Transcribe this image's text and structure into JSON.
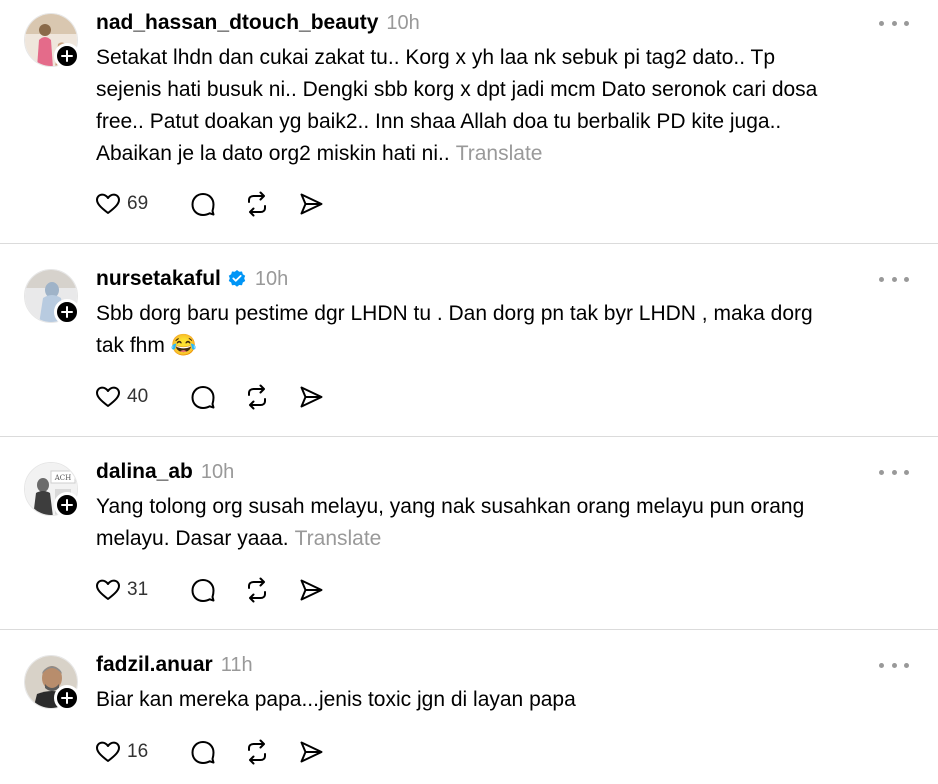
{
  "posts": [
    {
      "username": "nad_hassan_dtouch_beauty",
      "verified": false,
      "time": "10h",
      "lines": [
        "Setakat lhdn dan cukai zakat tu.. Korg x yh laa nk sebuk pi tag2 dato.. Tp",
        "sejenis hati busuk ni.. Dengki sbb korg x dpt jadi mcm Dato seronok cari dosa",
        "free.. Patut doakan yg baik2.. Inn shaa Allah doa tu berbalik PD kite juga..",
        "Abaikan je la dato org2 miskin hati ni.."
      ],
      "translate": "Translate",
      "likes": "69",
      "avatar_icon": "avatar-pink-figure-icon"
    },
    {
      "username": "nursetakaful",
      "verified": true,
      "time": "10h",
      "lines": [
        "Sbb dorg baru pestime dgr LHDN tu . Dan dorg pn tak byr LHDN , maka dorg",
        "tak fhm 😂"
      ],
      "translate": "",
      "likes": "40",
      "avatar_icon": "avatar-light-blue-figure-icon"
    },
    {
      "username": "dalina_ab",
      "verified": false,
      "time": "10h",
      "lines": [
        "Yang tolong org susah melayu, yang nak susahkan orang melayu pun orang",
        "melayu. Dasar yaaa."
      ],
      "translate": "Translate",
      "likes": "31",
      "avatar_icon": "avatar-shop-sign-icon"
    },
    {
      "username": "fadzil.anuar",
      "verified": false,
      "time": "11h",
      "lines": [
        "Biar kan mereka papa...jenis toxic jgn di layan papa"
      ],
      "translate": "",
      "likes": "16",
      "avatar_icon": "avatar-man-portrait-icon"
    }
  ],
  "colors": {
    "text": "#000000",
    "muted": "#999999",
    "verified_blue": "#0095f6",
    "divider": "#dbdbdb"
  }
}
